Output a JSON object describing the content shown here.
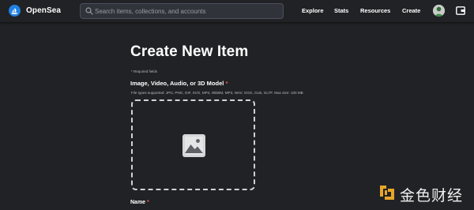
{
  "header": {
    "brand": "OpenSea",
    "search": {
      "placeholder": "Search items, collections, and accounts"
    },
    "nav": [
      "Explore",
      "Stats",
      "Resources",
      "Create"
    ],
    "avatar_icon": "user-avatar",
    "wallet_icon": "wallet-icon",
    "logo_icon": "opensea-sailboat-logo"
  },
  "main": {
    "title": "Create New Item",
    "required_note": "* Required fields",
    "media_label": "Image, Video, Audio, or 3D Model",
    "media_required": "*",
    "file_types": "File types supported: JPG, PNG, GIF, SVG, MP4, WEBM, MP3, WAV, OGG, GLB, GLTF. Max size: 100 MB",
    "dropzone_icon": "image-placeholder-icon",
    "name_label": "Name",
    "name_required": "*"
  },
  "watermark": {
    "text": "金色财经",
    "logo_icon": "jinse-logo"
  },
  "colors": {
    "background": "#202225",
    "brand_blue": "#2081e2",
    "required_red": "#eb5757",
    "watermark_gold": "#e8a628"
  }
}
